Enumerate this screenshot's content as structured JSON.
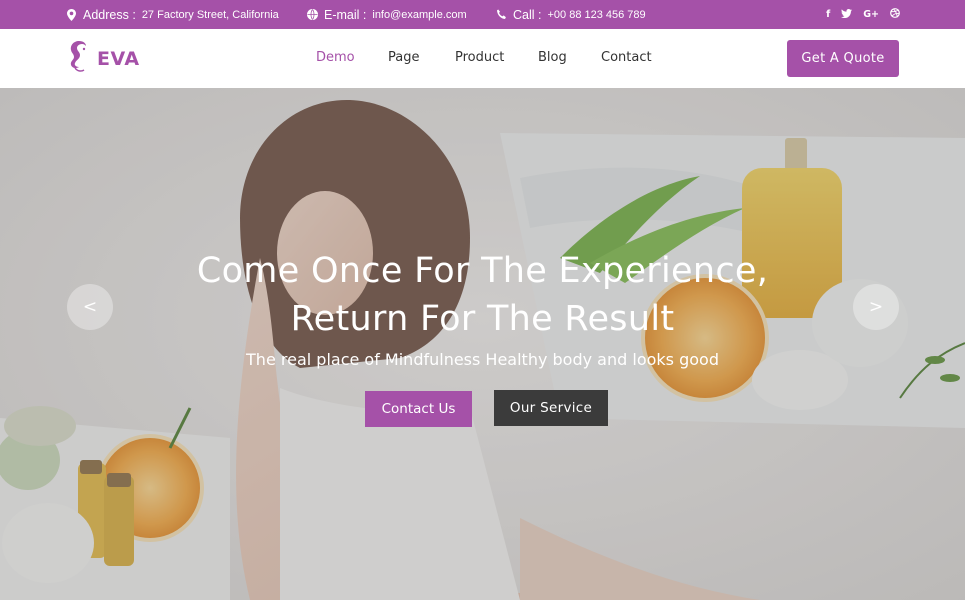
{
  "topbar": {
    "address_label": "Address :",
    "address_value": "27 Factory Street, California",
    "email_label": "E-mail :",
    "email_value": "info@example.com",
    "call_label": "Call :",
    "call_value": "+00 88 123 456 789",
    "socials": [
      "f",
      "t",
      "G+",
      "d"
    ],
    "icons": [
      "location-pin-icon",
      "globe-icon",
      "phone-icon"
    ]
  },
  "brand": {
    "name": "EVA",
    "logo_icon": "woman-silhouette-icon"
  },
  "nav": {
    "items": [
      "Demo",
      "Page",
      "Product",
      "Blog",
      "Contact"
    ],
    "active": "Demo",
    "quote_label": "Get A Quote"
  },
  "hero": {
    "title_line1": "Come Once For The Experience,",
    "title_line2": "Return For The Result",
    "subtitle": "The real place of Mindfulness Healthy body and looks good",
    "contact_label": "Contact Us",
    "service_label": "Our Service",
    "prev_label": "<",
    "next_label": ">"
  },
  "colors": {
    "accent": "#a551a8",
    "dark_button": "#3b3b3b",
    "topbar": "#a551a8"
  }
}
